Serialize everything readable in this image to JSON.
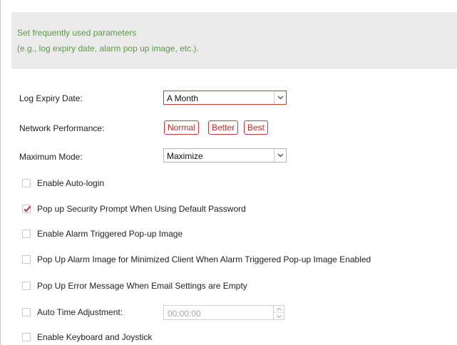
{
  "info": {
    "line1": "Set frequently used parameters",
    "line2": "(e.g., log expiry date, alarm pop up image, etc.)."
  },
  "log_expiry": {
    "label": "Log Expiry Date:",
    "value": "A Month"
  },
  "network_performance": {
    "label": "Network Performance:",
    "options": [
      "Normal",
      "Better",
      "Best"
    ]
  },
  "maximum_mode": {
    "label": "Maximum Mode:",
    "value": "Maximize"
  },
  "checkboxes": [
    {
      "label": "Enable Auto-login",
      "checked": false
    },
    {
      "label": "Pop up Security Prompt When Using Default Password",
      "checked": true
    },
    {
      "label": "Enable Alarm Triggered Pop-up Image",
      "checked": false
    },
    {
      "label": "Pop Up Alarm Image for Minimized Client When Alarm Triggered Pop-up Image Enabled",
      "checked": false
    },
    {
      "label": "Pop Up Error Message When Email Settings are Empty",
      "checked": false
    },
    {
      "label": "Auto Time Adjustment:",
      "checked": false
    },
    {
      "label": "Enable Keyboard and Joystick",
      "checked": false
    }
  ],
  "auto_time": {
    "value": "00:00:00"
  },
  "colors": {
    "accent": "#c0302f",
    "info_text": "#5a9a43",
    "info_bg": "#ebebeb"
  }
}
